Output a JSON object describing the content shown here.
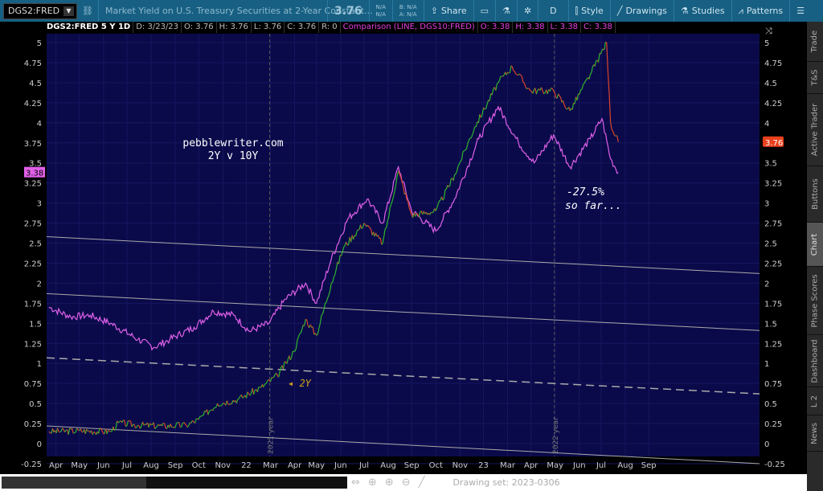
{
  "toolbar": {
    "symbol": "DGS2:FRED",
    "description": "Market Yield on U.S. Treasury Securities at 2-Year Constant...",
    "last": "3.76",
    "change_top": "N/A",
    "change_bottom": "N/A",
    "bid": "B: N/A",
    "ask": "A: N/A",
    "share": "Share",
    "aggregation": "D",
    "style": "Style",
    "drawings": "Drawings",
    "studies": "Studies",
    "patterns": "Patterns"
  },
  "legend": {
    "title": "DGS2:FRED 5 Y 1D",
    "date": "D: 3/23/23",
    "open": "O: 3.76",
    "high": "H: 3.76",
    "low": "L: 3.76",
    "close": "C: 3.76",
    "range": "R: 0",
    "comparison": "Comparison (LINE, DGS10:FRED)",
    "c_open": "O: 3.38",
    "c_high": "H: 3.38",
    "c_low": "L: 3.38",
    "c_close": "C: 3.38"
  },
  "chart_data": {
    "type": "line",
    "ylim": [
      -0.25,
      5.25
    ],
    "y_ticks": [
      "-0.25",
      "0",
      "0.25",
      "0.5",
      "0.75",
      "1",
      "1.25",
      "1.5",
      "1.75",
      "2",
      "2.25",
      "2.5",
      "2.75",
      "3",
      "3.25",
      "3.5",
      "3.75",
      "4",
      "4.25",
      "4.5",
      "4.75",
      "5"
    ],
    "x_ticks": [
      "Apr",
      "May",
      "Jun",
      "Jul",
      "Aug",
      "Sep",
      "Oct",
      "Nov",
      "22",
      "Mar",
      "Apr",
      "May",
      "Jun",
      "Jul",
      "Aug",
      "Sep",
      "Oct",
      "Nov",
      "23",
      "Mar",
      "Apr",
      "May",
      "Jun",
      "Jul",
      "Aug",
      "Sep"
    ],
    "xlim": [
      "2021-03-20",
      "2023-09-20"
    ],
    "series": [
      {
        "name": "DGS2:FRED",
        "color_up": "#2fb52f",
        "color_down": "#d9442a",
        "points": [
          [
            "2021-03-23",
            0.15
          ],
          [
            "2021-05-01",
            0.16
          ],
          [
            "2021-06-10",
            0.15
          ],
          [
            "2021-06-20",
            0.26
          ],
          [
            "2021-07-15",
            0.23
          ],
          [
            "2021-08-15",
            0.22
          ],
          [
            "2021-09-15",
            0.23
          ],
          [
            "2021-10-01",
            0.3
          ],
          [
            "2021-10-25",
            0.5
          ],
          [
            "2021-11-20",
            0.55
          ],
          [
            "2021-12-20",
            0.7
          ],
          [
            "2022-01-10",
            0.85
          ],
          [
            "2022-01-31",
            1.15
          ],
          [
            "2022-02-15",
            1.55
          ],
          [
            "2022-03-01",
            1.35
          ],
          [
            "2022-03-20",
            2.0
          ],
          [
            "2022-04-05",
            2.45
          ],
          [
            "2022-05-01",
            2.75
          ],
          [
            "2022-05-25",
            2.5
          ],
          [
            "2022-06-14",
            3.4
          ],
          [
            "2022-07-01",
            2.85
          ],
          [
            "2022-08-01",
            2.9
          ],
          [
            "2022-08-25",
            3.35
          ],
          [
            "2022-09-20",
            3.95
          ],
          [
            "2022-10-20",
            4.5
          ],
          [
            "2022-11-07",
            4.7
          ],
          [
            "2022-11-30",
            4.4
          ],
          [
            "2022-12-30",
            4.4
          ],
          [
            "2023-01-20",
            4.15
          ],
          [
            "2023-02-15",
            4.6
          ],
          [
            "2023-03-08",
            5.0
          ],
          [
            "2023-03-13",
            4.0
          ],
          [
            "2023-03-23",
            3.76
          ]
        ]
      },
      {
        "name": "DGS10:FRED",
        "color": "#e060e8",
        "points": [
          [
            "2021-03-23",
            1.7
          ],
          [
            "2021-04-20",
            1.58
          ],
          [
            "2021-05-15",
            1.6
          ],
          [
            "2021-06-10",
            1.5
          ],
          [
            "2021-07-15",
            1.3
          ],
          [
            "2021-08-05",
            1.2
          ],
          [
            "2021-08-25",
            1.3
          ],
          [
            "2021-09-25",
            1.45
          ],
          [
            "2021-10-20",
            1.65
          ],
          [
            "2021-11-15",
            1.6
          ],
          [
            "2021-12-05",
            1.4
          ],
          [
            "2021-12-30",
            1.5
          ],
          [
            "2022-01-20",
            1.8
          ],
          [
            "2022-02-15",
            2.0
          ],
          [
            "2022-03-01",
            1.75
          ],
          [
            "2022-03-20",
            2.3
          ],
          [
            "2022-04-10",
            2.8
          ],
          [
            "2022-05-05",
            3.05
          ],
          [
            "2022-05-25",
            2.75
          ],
          [
            "2022-06-14",
            3.45
          ],
          [
            "2022-07-01",
            2.9
          ],
          [
            "2022-08-01",
            2.65
          ],
          [
            "2022-08-25",
            3.05
          ],
          [
            "2022-09-25",
            3.8
          ],
          [
            "2022-10-20",
            4.2
          ],
          [
            "2022-11-15",
            3.75
          ],
          [
            "2022-12-05",
            3.5
          ],
          [
            "2022-12-30",
            3.85
          ],
          [
            "2023-01-20",
            3.45
          ],
          [
            "2023-02-15",
            3.8
          ],
          [
            "2023-03-02",
            4.05
          ],
          [
            "2023-03-13",
            3.55
          ],
          [
            "2023-03-23",
            3.38
          ]
        ]
      }
    ],
    "drawings": [
      {
        "start": [
          "2021-03-20",
          2.58
        ],
        "end": [
          "2023-09-20",
          2.12
        ],
        "style": "solid"
      },
      {
        "start": [
          "2021-03-20",
          1.87
        ],
        "end": [
          "2023-09-20",
          1.41
        ],
        "style": "solid"
      },
      {
        "start": [
          "2021-03-20",
          1.07
        ],
        "end": [
          "2023-09-20",
          0.62
        ],
        "style": "dashed"
      },
      {
        "start": [
          "2021-03-20",
          0.22
        ],
        "end": [
          "2023-09-20",
          -0.25
        ],
        "style": "solid"
      }
    ],
    "year_markers": [
      {
        "date": "2021-12-31",
        "label": "2021 year"
      },
      {
        "date": "2022-12-31",
        "label": "2022 year"
      }
    ],
    "annotations": [
      {
        "text": "pebblewriter.com",
        "color": "#ffffff"
      },
      {
        "text": "2Y v 10Y",
        "color": "#ffffff"
      },
      {
        "text": "2Y",
        "color": "#d4a020"
      },
      {
        "text": "-27.5%",
        "color": "#ffffff"
      },
      {
        "text": "so far...",
        "color": "#ffffff"
      }
    ],
    "price_labels": {
      "right": "3.76",
      "left": "3.38"
    }
  },
  "sidebar": [
    "Trade",
    "T&S",
    "Active Trader",
    "Buttons",
    "Chart",
    "Phase Scores",
    "Dashboard",
    "L 2",
    "News"
  ],
  "bottom": {
    "drawing_set": "Drawing set: 2023-0306"
  }
}
